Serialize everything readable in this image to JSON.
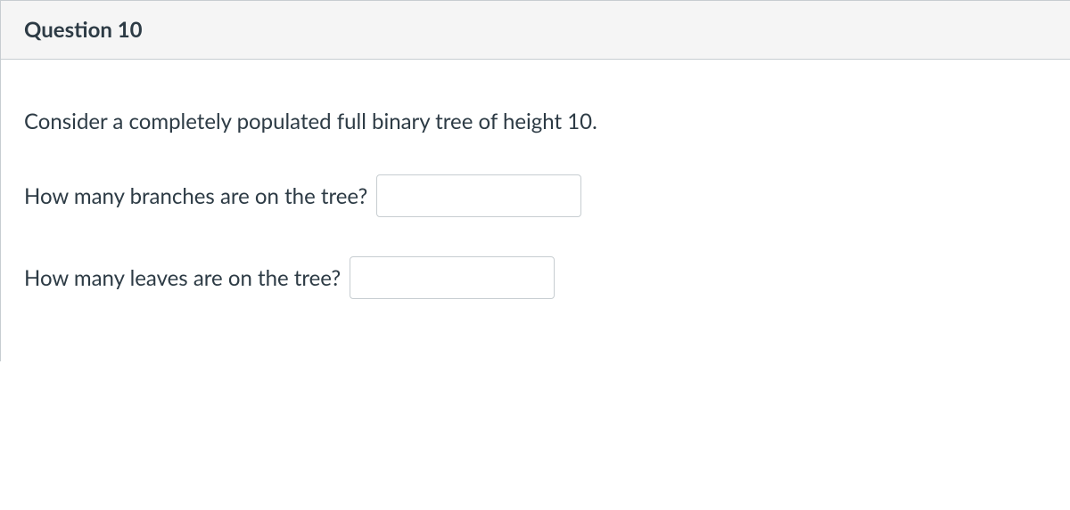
{
  "question": {
    "title": "Question 10",
    "prompt": "Consider a completely populated full binary tree of height 10.",
    "fields": [
      {
        "label": "How many branches are on the tree?",
        "value": ""
      },
      {
        "label": "How many leaves are on the tree?",
        "value": ""
      }
    ]
  }
}
